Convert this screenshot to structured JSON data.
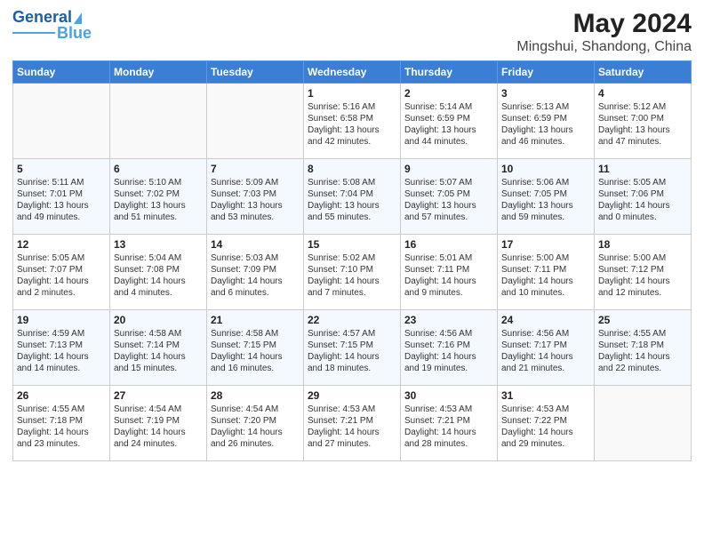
{
  "logo": {
    "line1": "General",
    "line2": "Blue"
  },
  "title": "May 2024",
  "subtitle": "Mingshui, Shandong, China",
  "weekdays": [
    "Sunday",
    "Monday",
    "Tuesday",
    "Wednesday",
    "Thursday",
    "Friday",
    "Saturday"
  ],
  "weeks": [
    [
      {
        "day": "",
        "info": ""
      },
      {
        "day": "",
        "info": ""
      },
      {
        "day": "",
        "info": ""
      },
      {
        "day": "1",
        "info": "Sunrise: 5:16 AM\nSunset: 6:58 PM\nDaylight: 13 hours\nand 42 minutes."
      },
      {
        "day": "2",
        "info": "Sunrise: 5:14 AM\nSunset: 6:59 PM\nDaylight: 13 hours\nand 44 minutes."
      },
      {
        "day": "3",
        "info": "Sunrise: 5:13 AM\nSunset: 6:59 PM\nDaylight: 13 hours\nand 46 minutes."
      },
      {
        "day": "4",
        "info": "Sunrise: 5:12 AM\nSunset: 7:00 PM\nDaylight: 13 hours\nand 47 minutes."
      }
    ],
    [
      {
        "day": "5",
        "info": "Sunrise: 5:11 AM\nSunset: 7:01 PM\nDaylight: 13 hours\nand 49 minutes."
      },
      {
        "day": "6",
        "info": "Sunrise: 5:10 AM\nSunset: 7:02 PM\nDaylight: 13 hours\nand 51 minutes."
      },
      {
        "day": "7",
        "info": "Sunrise: 5:09 AM\nSunset: 7:03 PM\nDaylight: 13 hours\nand 53 minutes."
      },
      {
        "day": "8",
        "info": "Sunrise: 5:08 AM\nSunset: 7:04 PM\nDaylight: 13 hours\nand 55 minutes."
      },
      {
        "day": "9",
        "info": "Sunrise: 5:07 AM\nSunset: 7:05 PM\nDaylight: 13 hours\nand 57 minutes."
      },
      {
        "day": "10",
        "info": "Sunrise: 5:06 AM\nSunset: 7:05 PM\nDaylight: 13 hours\nand 59 minutes."
      },
      {
        "day": "11",
        "info": "Sunrise: 5:05 AM\nSunset: 7:06 PM\nDaylight: 14 hours\nand 0 minutes."
      }
    ],
    [
      {
        "day": "12",
        "info": "Sunrise: 5:05 AM\nSunset: 7:07 PM\nDaylight: 14 hours\nand 2 minutes."
      },
      {
        "day": "13",
        "info": "Sunrise: 5:04 AM\nSunset: 7:08 PM\nDaylight: 14 hours\nand 4 minutes."
      },
      {
        "day": "14",
        "info": "Sunrise: 5:03 AM\nSunset: 7:09 PM\nDaylight: 14 hours\nand 6 minutes."
      },
      {
        "day": "15",
        "info": "Sunrise: 5:02 AM\nSunset: 7:10 PM\nDaylight: 14 hours\nand 7 minutes."
      },
      {
        "day": "16",
        "info": "Sunrise: 5:01 AM\nSunset: 7:11 PM\nDaylight: 14 hours\nand 9 minutes."
      },
      {
        "day": "17",
        "info": "Sunrise: 5:00 AM\nSunset: 7:11 PM\nDaylight: 14 hours\nand 10 minutes."
      },
      {
        "day": "18",
        "info": "Sunrise: 5:00 AM\nSunset: 7:12 PM\nDaylight: 14 hours\nand 12 minutes."
      }
    ],
    [
      {
        "day": "19",
        "info": "Sunrise: 4:59 AM\nSunset: 7:13 PM\nDaylight: 14 hours\nand 14 minutes."
      },
      {
        "day": "20",
        "info": "Sunrise: 4:58 AM\nSunset: 7:14 PM\nDaylight: 14 hours\nand 15 minutes."
      },
      {
        "day": "21",
        "info": "Sunrise: 4:58 AM\nSunset: 7:15 PM\nDaylight: 14 hours\nand 16 minutes."
      },
      {
        "day": "22",
        "info": "Sunrise: 4:57 AM\nSunset: 7:15 PM\nDaylight: 14 hours\nand 18 minutes."
      },
      {
        "day": "23",
        "info": "Sunrise: 4:56 AM\nSunset: 7:16 PM\nDaylight: 14 hours\nand 19 minutes."
      },
      {
        "day": "24",
        "info": "Sunrise: 4:56 AM\nSunset: 7:17 PM\nDaylight: 14 hours\nand 21 minutes."
      },
      {
        "day": "25",
        "info": "Sunrise: 4:55 AM\nSunset: 7:18 PM\nDaylight: 14 hours\nand 22 minutes."
      }
    ],
    [
      {
        "day": "26",
        "info": "Sunrise: 4:55 AM\nSunset: 7:18 PM\nDaylight: 14 hours\nand 23 minutes."
      },
      {
        "day": "27",
        "info": "Sunrise: 4:54 AM\nSunset: 7:19 PM\nDaylight: 14 hours\nand 24 minutes."
      },
      {
        "day": "28",
        "info": "Sunrise: 4:54 AM\nSunset: 7:20 PM\nDaylight: 14 hours\nand 26 minutes."
      },
      {
        "day": "29",
        "info": "Sunrise: 4:53 AM\nSunset: 7:21 PM\nDaylight: 14 hours\nand 27 minutes."
      },
      {
        "day": "30",
        "info": "Sunrise: 4:53 AM\nSunset: 7:21 PM\nDaylight: 14 hours\nand 28 minutes."
      },
      {
        "day": "31",
        "info": "Sunrise: 4:53 AM\nSunset: 7:22 PM\nDaylight: 14 hours\nand 29 minutes."
      },
      {
        "day": "",
        "info": ""
      }
    ]
  ]
}
